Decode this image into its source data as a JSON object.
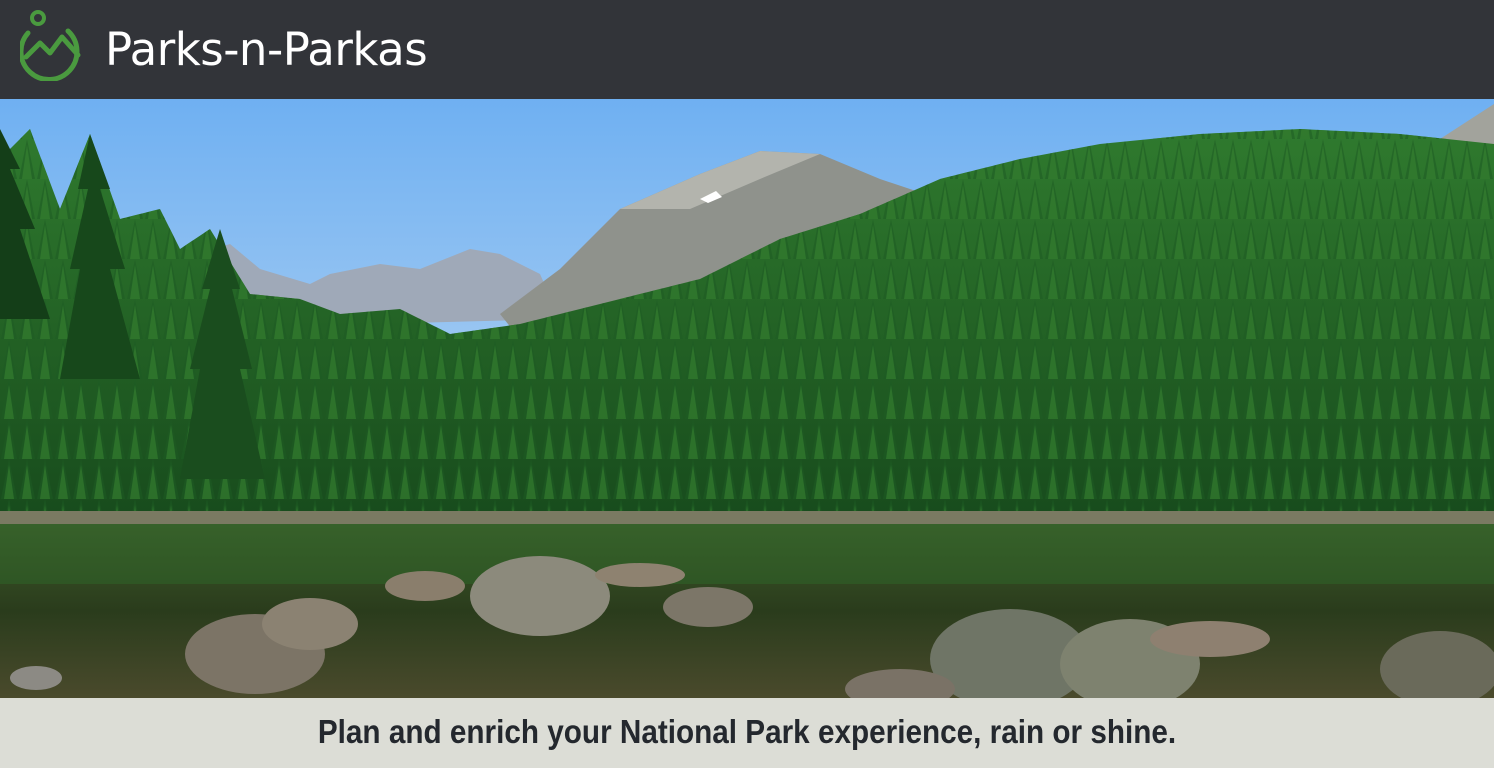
{
  "header": {
    "brand_name": "Parks-n-Parkas",
    "logo_icon": "mountain-person-logo-icon",
    "background": "#323439",
    "logo_color": "#4a9a3f"
  },
  "hero": {
    "image_icon": "alpine-lake-forest-photo",
    "sky_color": "#7cb6f0",
    "forest_color": "#1e5a24"
  },
  "tagline": {
    "text": "Plan and enrich your National Park experience, rain or shine.",
    "background": "#dcddd6",
    "color": "#24282e"
  }
}
